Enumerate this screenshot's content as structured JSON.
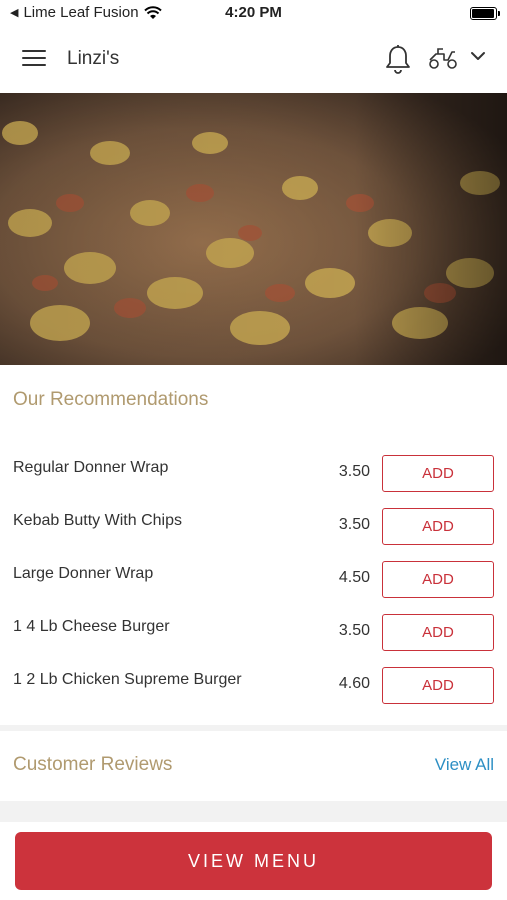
{
  "status_bar": {
    "back_glyph": "◀",
    "carrier": "Lime Leaf Fusion",
    "time": "4:20 PM",
    "battery_level": 0.95
  },
  "nav": {
    "title": "Linzi's",
    "icons": [
      "menu-icon",
      "bell-icon",
      "scooter-icon",
      "chevron-down-icon"
    ]
  },
  "recommendations": {
    "title": "Our Recommendations",
    "add_label": "ADD",
    "items": [
      {
        "name": "Regular Donner Wrap",
        "price": "3.50"
      },
      {
        "name": "Kebab Butty With Chips",
        "price": "3.50"
      },
      {
        "name": "Large Donner Wrap",
        "price": "4.50"
      },
      {
        "name": "1 4 Lb Cheese Burger",
        "price": "3.50"
      },
      {
        "name": "1 2 Lb Chicken Supreme Burger",
        "price": "4.60"
      }
    ]
  },
  "reviews": {
    "title": "Customer Reviews",
    "view_all_label": "View All"
  },
  "bottom": {
    "view_menu_label": "VIEW MENU"
  },
  "colors": {
    "accent_red": "#cc333c",
    "section_title": "#b09a6f",
    "link_blue": "#2d8fc4"
  }
}
